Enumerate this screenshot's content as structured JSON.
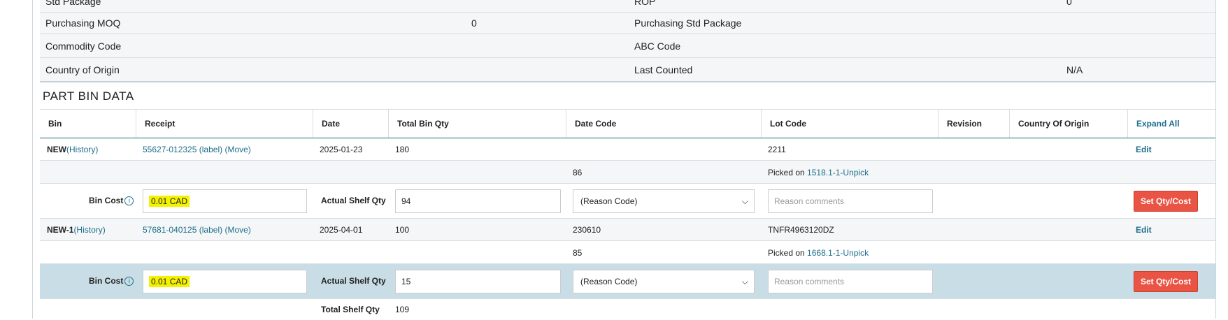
{
  "properties": [
    {
      "label1": "Std Package",
      "value1": "",
      "label2": "ROP",
      "value2": "0"
    },
    {
      "label1": "Purchasing MOQ",
      "value1": "0",
      "label2": "Purchasing Std Package",
      "value2": ""
    },
    {
      "label1": "Commodity Code",
      "value1": "",
      "label2": "ABC Code",
      "value2": ""
    },
    {
      "label1": "Country of Origin",
      "value1": "",
      "label2": "Last Counted",
      "value2": "N/A"
    }
  ],
  "section_title": "PART BIN DATA",
  "columns": {
    "bin": "Bin",
    "receipt": "Receipt",
    "date": "Date",
    "total_bin_qty": "Total Bin Qty",
    "date_code": "Date Code",
    "lot_code": "Lot Code",
    "revision": "Revision",
    "country_of_origin": "Country Of Origin",
    "expand_all": "Expand All"
  },
  "bins": [
    {
      "name": "NEW",
      "history": "(History)",
      "receipt": "55627-012325",
      "label": "(label)",
      "move": "(Move)",
      "date": "2025-01-23",
      "total_bin_qty": "180",
      "date_code": "",
      "lot_code": "2211",
      "edit": "Edit",
      "pick_qty": "86",
      "picked_on": "Picked on",
      "picked_ref": "1518.1-1-Unpick",
      "bin_cost_label": "Bin Cost",
      "bin_cost": "0.01 CAD",
      "actual_shelf_qty_label": "Actual Shelf Qty",
      "actual_shelf_qty": "94",
      "reason_code": "(Reason Code)",
      "reason_placeholder": "Reason comments",
      "set_button": "Set Qty/Cost"
    },
    {
      "name": "NEW-1",
      "history": "(History)",
      "receipt": "57681-040125",
      "label": "(label)",
      "move": "(Move)",
      "date": "2025-04-01",
      "total_bin_qty": "100",
      "date_code": "230610",
      "lot_code": "TNFR4963120DZ",
      "edit": "Edit",
      "pick_qty": "85",
      "picked_on": "Picked on",
      "picked_ref": "1668.1-1-Unpick",
      "bin_cost_label": "Bin Cost",
      "bin_cost": "0.01 CAD",
      "actual_shelf_qty_label": "Actual Shelf Qty",
      "actual_shelf_qty": "15",
      "reason_code": "(Reason Code)",
      "reason_placeholder": "Reason comments",
      "set_button": "Set Qty/Cost"
    }
  ],
  "total_shelf_qty_label": "Total Shelf Qty",
  "total_shelf_qty": "109",
  "info_icon": "info-icon",
  "dropdown_icon": "chevron-down-icon"
}
